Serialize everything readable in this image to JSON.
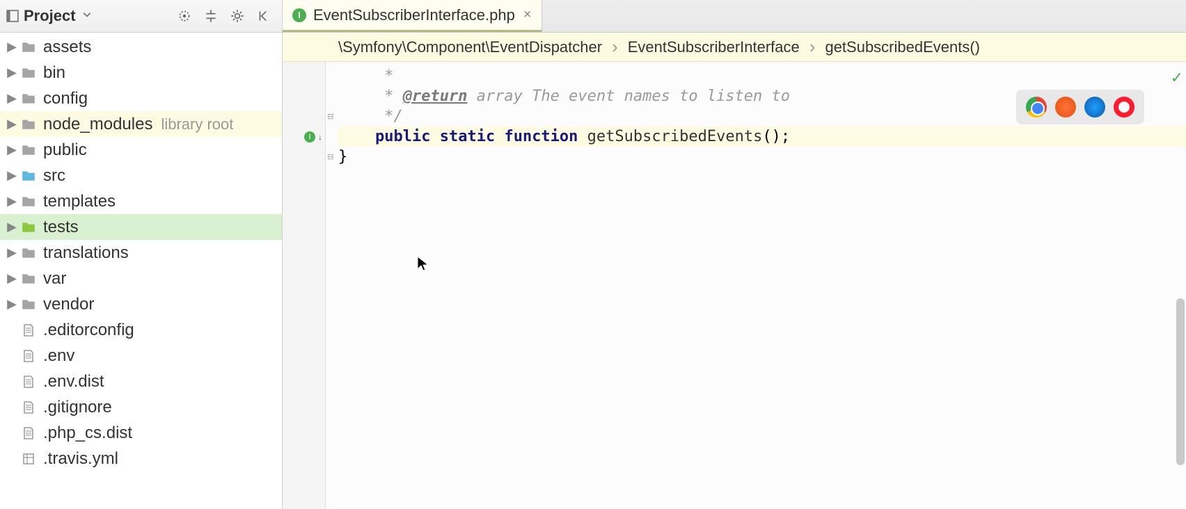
{
  "sidebar": {
    "title": "Project",
    "items": [
      {
        "label": "assets",
        "type": "folder",
        "color": "gray",
        "expandable": true
      },
      {
        "label": "bin",
        "type": "folder",
        "color": "gray",
        "expandable": true
      },
      {
        "label": "config",
        "type": "folder",
        "color": "gray",
        "expandable": true
      },
      {
        "label": "node_modules",
        "extra": "library root",
        "type": "folder",
        "color": "gray",
        "expandable": true,
        "highlighted": true
      },
      {
        "label": "public",
        "type": "folder",
        "color": "gray",
        "expandable": true
      },
      {
        "label": "src",
        "type": "folder",
        "color": "blue",
        "expandable": true
      },
      {
        "label": "templates",
        "type": "folder",
        "color": "gray",
        "expandable": true
      },
      {
        "label": "tests",
        "type": "folder",
        "color": "green",
        "expandable": true,
        "selected": true
      },
      {
        "label": "translations",
        "type": "folder",
        "color": "gray",
        "expandable": true
      },
      {
        "label": "var",
        "type": "folder",
        "color": "gray",
        "expandable": true
      },
      {
        "label": "vendor",
        "type": "folder",
        "color": "gray",
        "expandable": true
      },
      {
        "label": ".editorconfig",
        "type": "file",
        "expandable": false
      },
      {
        "label": ".env",
        "type": "file",
        "expandable": false
      },
      {
        "label": ".env.dist",
        "type": "file",
        "expandable": false
      },
      {
        "label": ".gitignore",
        "type": "file",
        "expandable": false
      },
      {
        "label": ".php_cs.dist",
        "type": "file",
        "expandable": false
      },
      {
        "label": ".travis.yml",
        "type": "file",
        "expandable": false
      }
    ]
  },
  "tab": {
    "icon_letter": "I",
    "label": "EventSubscriberInterface.php"
  },
  "breadcrumb": {
    "part1": "\\Symfony\\Component\\EventDispatcher",
    "part2": "EventSubscriberInterface",
    "part3": "getSubscribedEvents()"
  },
  "code": {
    "line1_star": "     *",
    "line2_star": "     * ",
    "line2_tag": "@return",
    "line2_rest": " array The event names to listen to",
    "line3_close": "     */",
    "line4_indent": "    ",
    "line4_kw1": "public",
    "line4_kw2": "static",
    "line4_kw3": "function",
    "line4_fn": "getSubscribedEvents",
    "line4_tail": "();",
    "line5_brace": "}"
  }
}
